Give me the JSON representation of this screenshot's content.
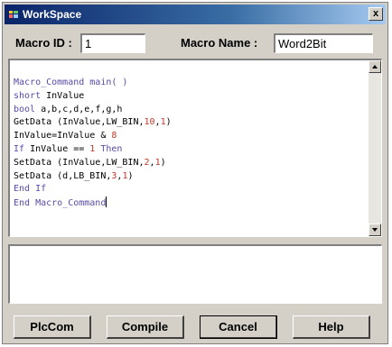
{
  "window": {
    "title": "WorkSpace",
    "close_label": "x"
  },
  "form": {
    "macro_id_label": "Macro ID :",
    "macro_id_value": "1",
    "macro_name_label": "Macro Name :",
    "macro_name_value": "Word2Bit"
  },
  "code_lines": [
    "Macro_Command main( )",
    "short InValue",
    "bool a,b,c,d,e,f,g,h",
    "GetData (InValue,LW_BIN,10,1)",
    "InValue=InValue & 8",
    "If InValue == 1 Then",
    "SetData (InValue,LW_BIN,2,1)",
    "SetData (d,LB_BIN,3,1)",
    "End If",
    "End Macro_Command"
  ],
  "buttons": {
    "plccom": "PlcCom",
    "compile": "Compile",
    "cancel": "Cancel",
    "help": "Help"
  },
  "colors": {
    "keyword": "#5a4aa8",
    "number": "#c0392b",
    "titlebar_start": "#0a246a",
    "face": "#d4d0c8"
  }
}
